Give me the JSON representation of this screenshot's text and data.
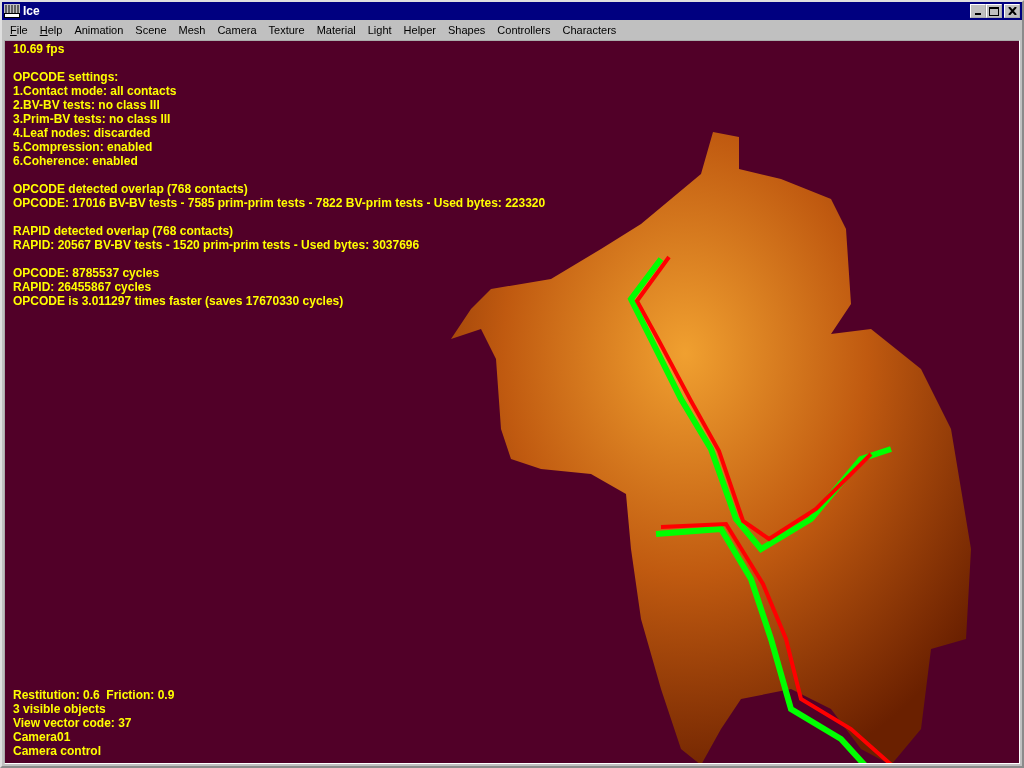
{
  "window": {
    "title": "Ice"
  },
  "menu": [
    {
      "label": "File",
      "mnemonic": true
    },
    {
      "label": "Help",
      "mnemonic": true
    },
    {
      "label": "Animation",
      "mnemonic": false
    },
    {
      "label": "Scene",
      "mnemonic": false
    },
    {
      "label": "Mesh",
      "mnemonic": false
    },
    {
      "label": "Camera",
      "mnemonic": false
    },
    {
      "label": "Texture",
      "mnemonic": false
    },
    {
      "label": "Material",
      "mnemonic": false
    },
    {
      "label": "Light",
      "mnemonic": false
    },
    {
      "label": "Helper",
      "mnemonic": false
    },
    {
      "label": "Shapes",
      "mnemonic": false
    },
    {
      "label": "Controllers",
      "mnemonic": false
    },
    {
      "label": "Characters",
      "mnemonic": false
    }
  ],
  "viewport": {
    "overlay_top": [
      [
        "10.69 fps"
      ],
      [
        "OPCODE settings:",
        "1.Contact mode: all contacts",
        "2.BV-BV tests: no class III",
        "3.Prim-BV tests: no class III",
        "4.Leaf nodes: discarded",
        "5.Compression: enabled",
        "6.Coherence: enabled"
      ],
      [
        "OPCODE detected overlap (768 contacts)",
        "OPCODE: 17016 BV-BV tests - 7585 prim-prim tests - 7822 BV-prim tests - Used bytes: 223320"
      ],
      [
        "RAPID detected overlap (768 contacts)",
        "RAPID: 20567 BV-BV tests - 1520 prim-prim tests - Used bytes: 3037696"
      ],
      [
        "OPCODE: 8785537 cycles",
        "RAPID: 26455867 cycles",
        "OPCODE is 3.011297 times faster (saves 17670330 cycles)"
      ]
    ],
    "overlay_bottom": [
      "Restitution: 0.6  Friction: 0.9",
      "3 visible objects",
      "View vector code: 37",
      "Camera01",
      "Camera control"
    ]
  }
}
